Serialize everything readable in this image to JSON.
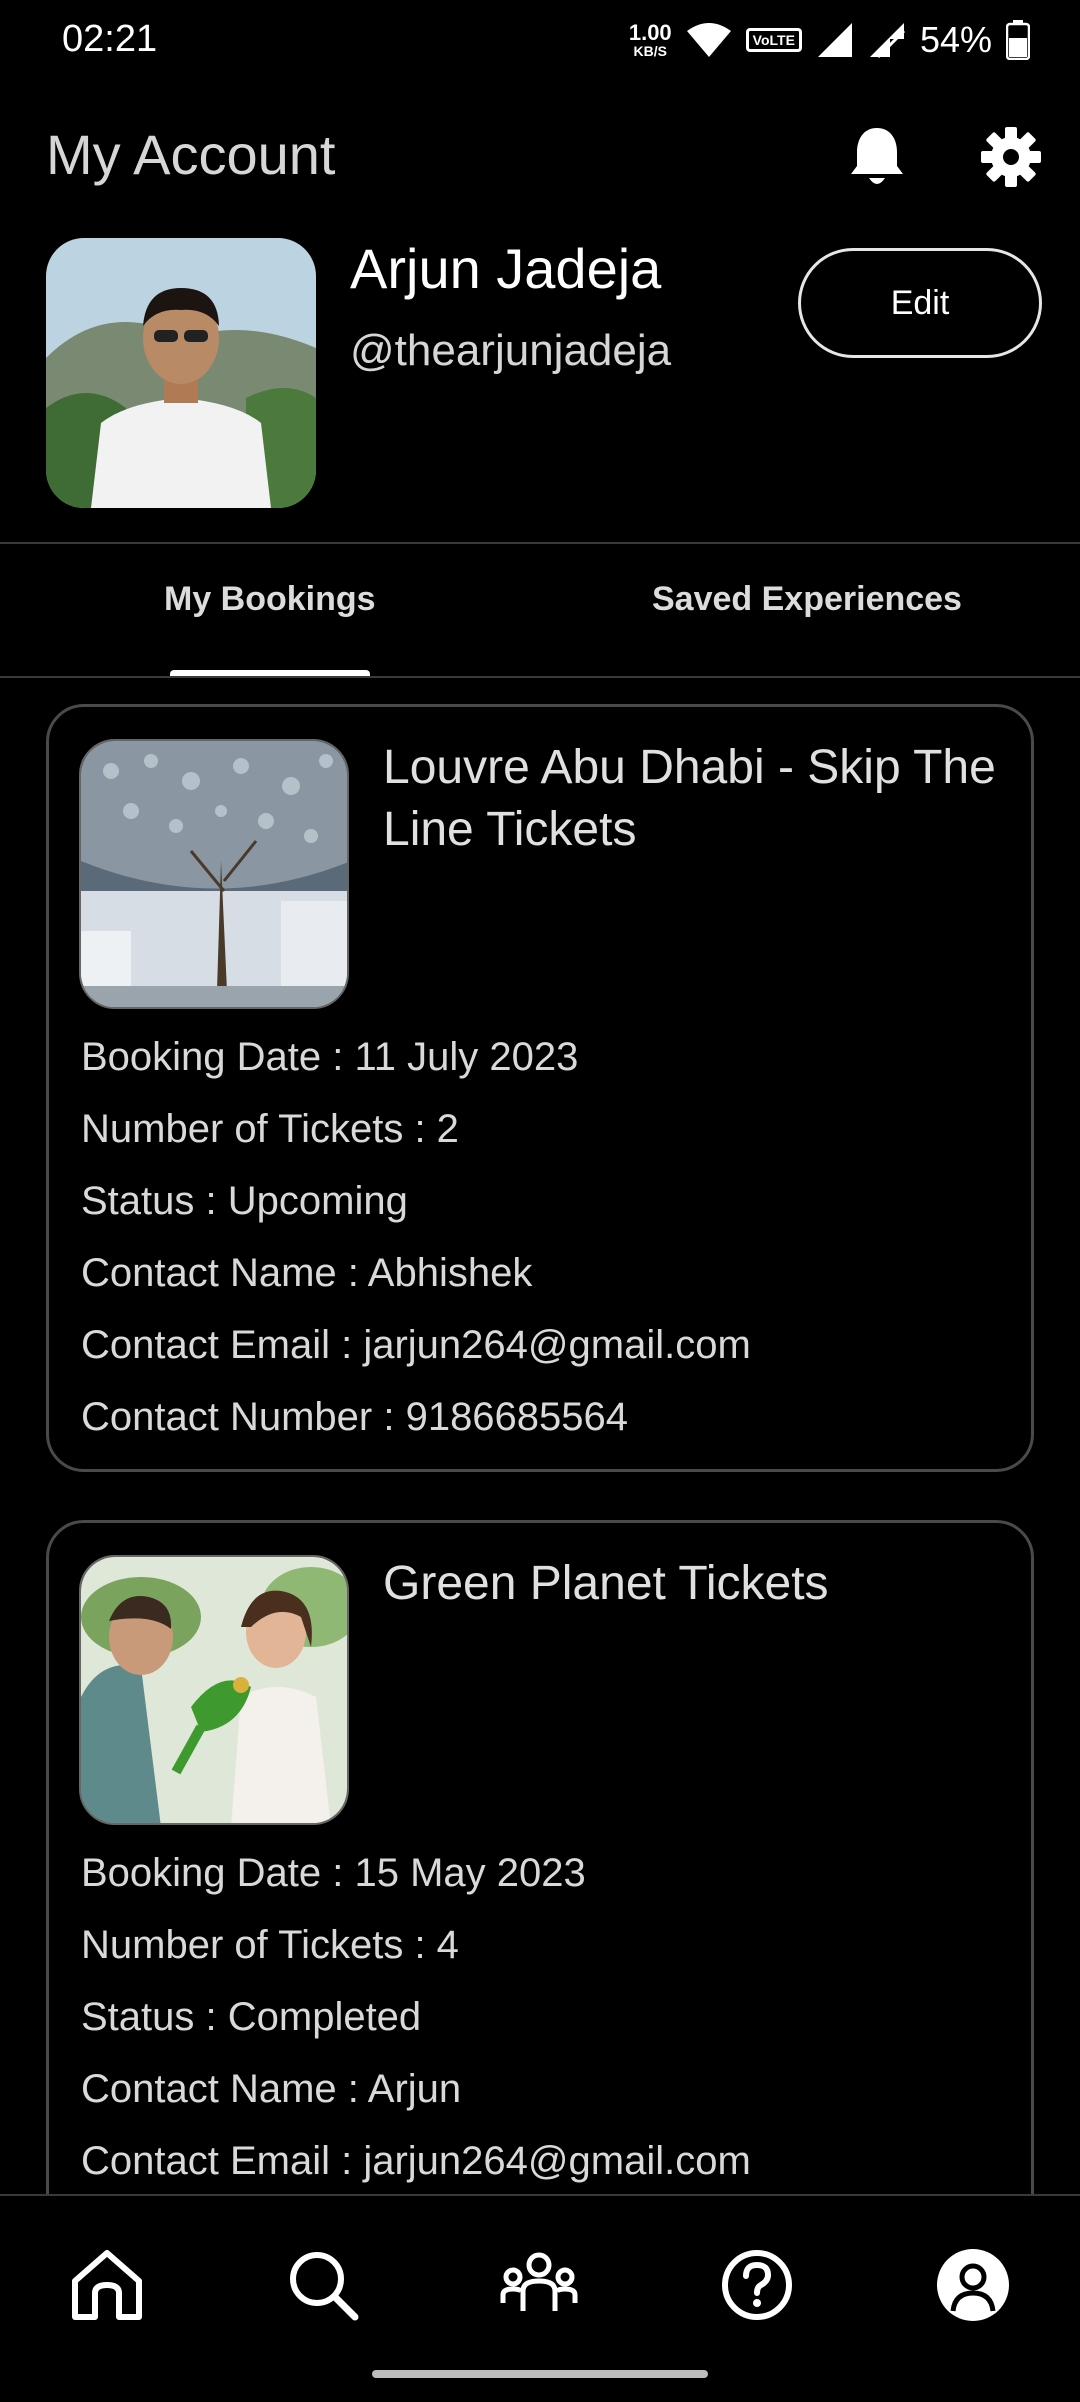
{
  "status_bar": {
    "time": "02:21",
    "net_speed_value": "1.00",
    "net_speed_unit": "KB/S",
    "volte": "VoLTE",
    "battery": "54%"
  },
  "header": {
    "title": "My Account",
    "icons": [
      "bell-icon",
      "gear-icon"
    ]
  },
  "profile": {
    "name": "Arjun Jadeja",
    "handle": "@thearjunjadeja",
    "edit_label": "Edit"
  },
  "tabs": [
    {
      "label": "My Bookings",
      "active": true
    },
    {
      "label": "Saved Experiences",
      "active": false
    }
  ],
  "bookings": [
    {
      "title": "Louvre Abu Dhabi - Skip The Line Tickets",
      "booking_date": "Booking Date : 11 July 2023",
      "tickets": "Number of Tickets : 2",
      "status": "Status : Upcoming",
      "contact_name": "Contact Name : Abhishek",
      "contact_email": "Contact Email : jarjun264@gmail.com",
      "contact_number": "Contact Number : 9186685564"
    },
    {
      "title": "Green Planet Tickets",
      "booking_date": "Booking Date : 15 May 2023",
      "tickets": "Number of Tickets : 4",
      "status": "Status : Completed",
      "contact_name": "Contact Name : Arjun",
      "contact_email": "Contact Email : jarjun264@gmail.com"
    }
  ],
  "bottom_nav": [
    "home-icon",
    "search-icon",
    "community-icon",
    "help-icon",
    "profile-icon"
  ],
  "colors": {
    "background": "#000000",
    "text": "#ffffff",
    "muted_text": "#d6d6d6",
    "card_border": "#4a4a4a"
  }
}
